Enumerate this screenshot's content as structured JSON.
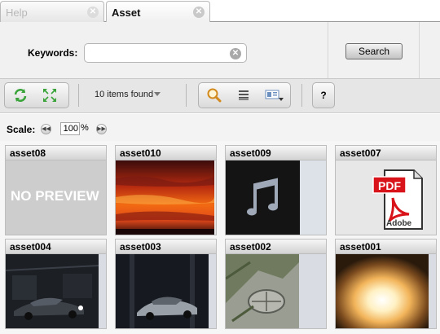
{
  "tabs": [
    {
      "label": "Help",
      "state": "inactive"
    },
    {
      "label": "Asset",
      "state": "active"
    }
  ],
  "search": {
    "label": "Keywords:",
    "value": "",
    "placeholder": "",
    "button_label": "Search"
  },
  "toolbar": {
    "refresh_icon": "refresh-icon",
    "expand_icon": "expand-icon",
    "count_label": "10 items found",
    "help_label": "?",
    "view_icons": [
      "magnifier-icon",
      "list-view-icon",
      "details-view-icon"
    ]
  },
  "scale": {
    "label": "Scale:",
    "value": "100",
    "unit": "%"
  },
  "assets": [
    {
      "name": "asset08",
      "thumb": "no-preview",
      "thumb_text": "NO PREVIEW"
    },
    {
      "name": "asset010",
      "thumb": "sunset"
    },
    {
      "name": "asset009",
      "thumb": "music-note"
    },
    {
      "name": "asset007",
      "thumb": "pdf",
      "thumb_text": "PDF",
      "thumb_sub": "Adobe"
    },
    {
      "name": "asset004",
      "thumb": "car-dark"
    },
    {
      "name": "asset003",
      "thumb": "car-silver"
    },
    {
      "name": "asset002",
      "thumb": "aerial"
    },
    {
      "name": "asset001",
      "thumb": "explosion"
    }
  ],
  "colors": {
    "accent_green": "#3aa33a",
    "search_button": "#c8c8c8",
    "tab_active_text": "#111111",
    "tab_inactive_text": "#b8b8b8"
  }
}
